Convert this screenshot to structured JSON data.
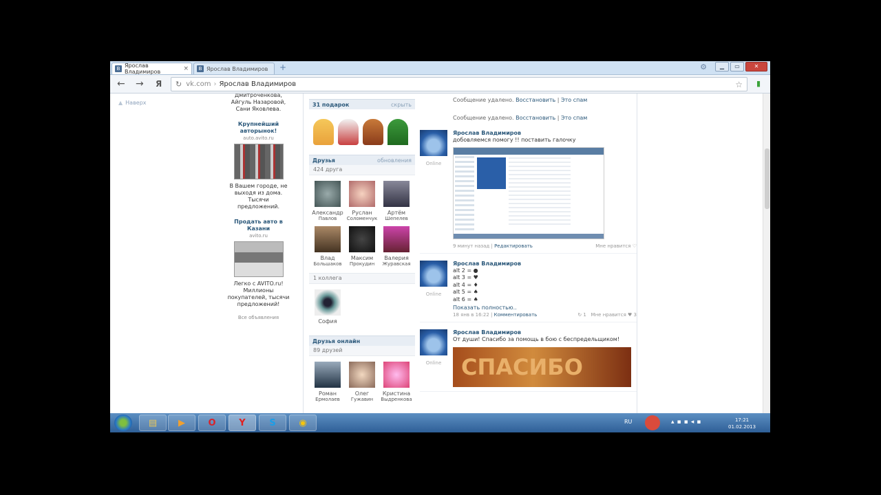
{
  "browser": {
    "tabs": [
      {
        "label": "Ярослав Владимиров",
        "icon": "vk-favicon",
        "active": true
      },
      {
        "label": "Ярослав Владимиров",
        "icon": "vk-favicon",
        "active": false
      }
    ],
    "yandex_btn": "Я",
    "address": {
      "domain": "vk.com",
      "separator": "›",
      "title": "Ярослав Владимиров"
    }
  },
  "page": {
    "up_link": "Наверх",
    "ads": {
      "top_text": "Дмитроченкова, Айгуль Назаровой, Сани Яковлева.",
      "items": [
        {
          "title": "Крупнейший авторынок!",
          "domain": "auto.avito.ru",
          "desc": "В Вашем городе, не выходя из дома. Тысячи предложений."
        },
        {
          "title": "Продать авто в Казани",
          "domain": "avito.ru",
          "desc": "Легко с AVITO.ru! Миллионы покупателей, тысячи предложений!"
        }
      ],
      "all_ads": "Все объявления"
    },
    "gifts": {
      "title": "31 подарок",
      "link": "скрыть"
    },
    "friends": {
      "title": "Друзья",
      "link": "обновления",
      "count": "424 друга",
      "list": [
        {
          "first": "Александр",
          "last": "Павлов"
        },
        {
          "first": "Руслан",
          "last": "Соломенчук"
        },
        {
          "first": "Артём",
          "last": "Шепелев"
        },
        {
          "first": "Влад",
          "last": "Большаков"
        },
        {
          "first": "Максим",
          "last": "Прокудин"
        },
        {
          "first": "Валерия",
          "last": "Журавская"
        }
      ]
    },
    "colleagues": {
      "count": "1 коллега",
      "list": [
        {
          "first": "София",
          "last": ""
        }
      ]
    },
    "online": {
      "title": "Друзья онлайн",
      "count": "89 друзей",
      "list": [
        {
          "first": "Роман",
          "last": "Ермолаев"
        },
        {
          "first": "Олег",
          "last": "Гужавин"
        },
        {
          "first": "Кристина",
          "last": "Выдренкова"
        }
      ]
    },
    "feed": {
      "deleted": [
        {
          "text": "Сообщение удалено.",
          "restore": "Восстановить",
          "sep": "|",
          "spam": "Это спам"
        },
        {
          "text": "Сообщение удалено.",
          "restore": "Восстановить",
          "sep": "|",
          "spam": "Это спам"
        }
      ],
      "posts": [
        {
          "author": "Ярослав Владимиров",
          "status": "Online",
          "text": "добовляемся помогу !! поставить галочку",
          "time": "9 минут назад",
          "sep": "|",
          "action": "Редактировать",
          "like": "Мне нравится ♡"
        },
        {
          "author": "Ярослав Владимиров",
          "status": "Online",
          "text": "alt 2 = ●\nalt 3 = ♥\nalt 4 = ♦\nalt 5 = ♠\nalt 6 = ♠",
          "more": "Показать полностью..",
          "time": "18 янв в 16:22",
          "sep": "|",
          "action": "Комментировать",
          "reposts": "↻ 1",
          "like": "Мне нравится ♥ 3"
        },
        {
          "author": "Ярослав Владимиров",
          "status": "Online",
          "text": "От души! Спасибо за помощь в бою с беспредельщиком!",
          "banner_text": "СПАСИБО"
        }
      ]
    }
  },
  "taskbar": {
    "apps": [
      {
        "name": "explorer",
        "glyph": "▤",
        "color": "#e8c65a"
      },
      {
        "name": "media-player",
        "glyph": "▶",
        "color": "#f0a030"
      },
      {
        "name": "opera",
        "glyph": "O",
        "color": "#d8232a"
      },
      {
        "name": "yandex-browser",
        "glyph": "Y",
        "color": "#e02020"
      },
      {
        "name": "skype",
        "glyph": "S",
        "color": "#1a9ee8"
      },
      {
        "name": "recorder",
        "glyph": "◉",
        "color": "#f4c40f"
      }
    ],
    "lang": "RU",
    "time": "17:21",
    "date": "01.02.2013"
  }
}
